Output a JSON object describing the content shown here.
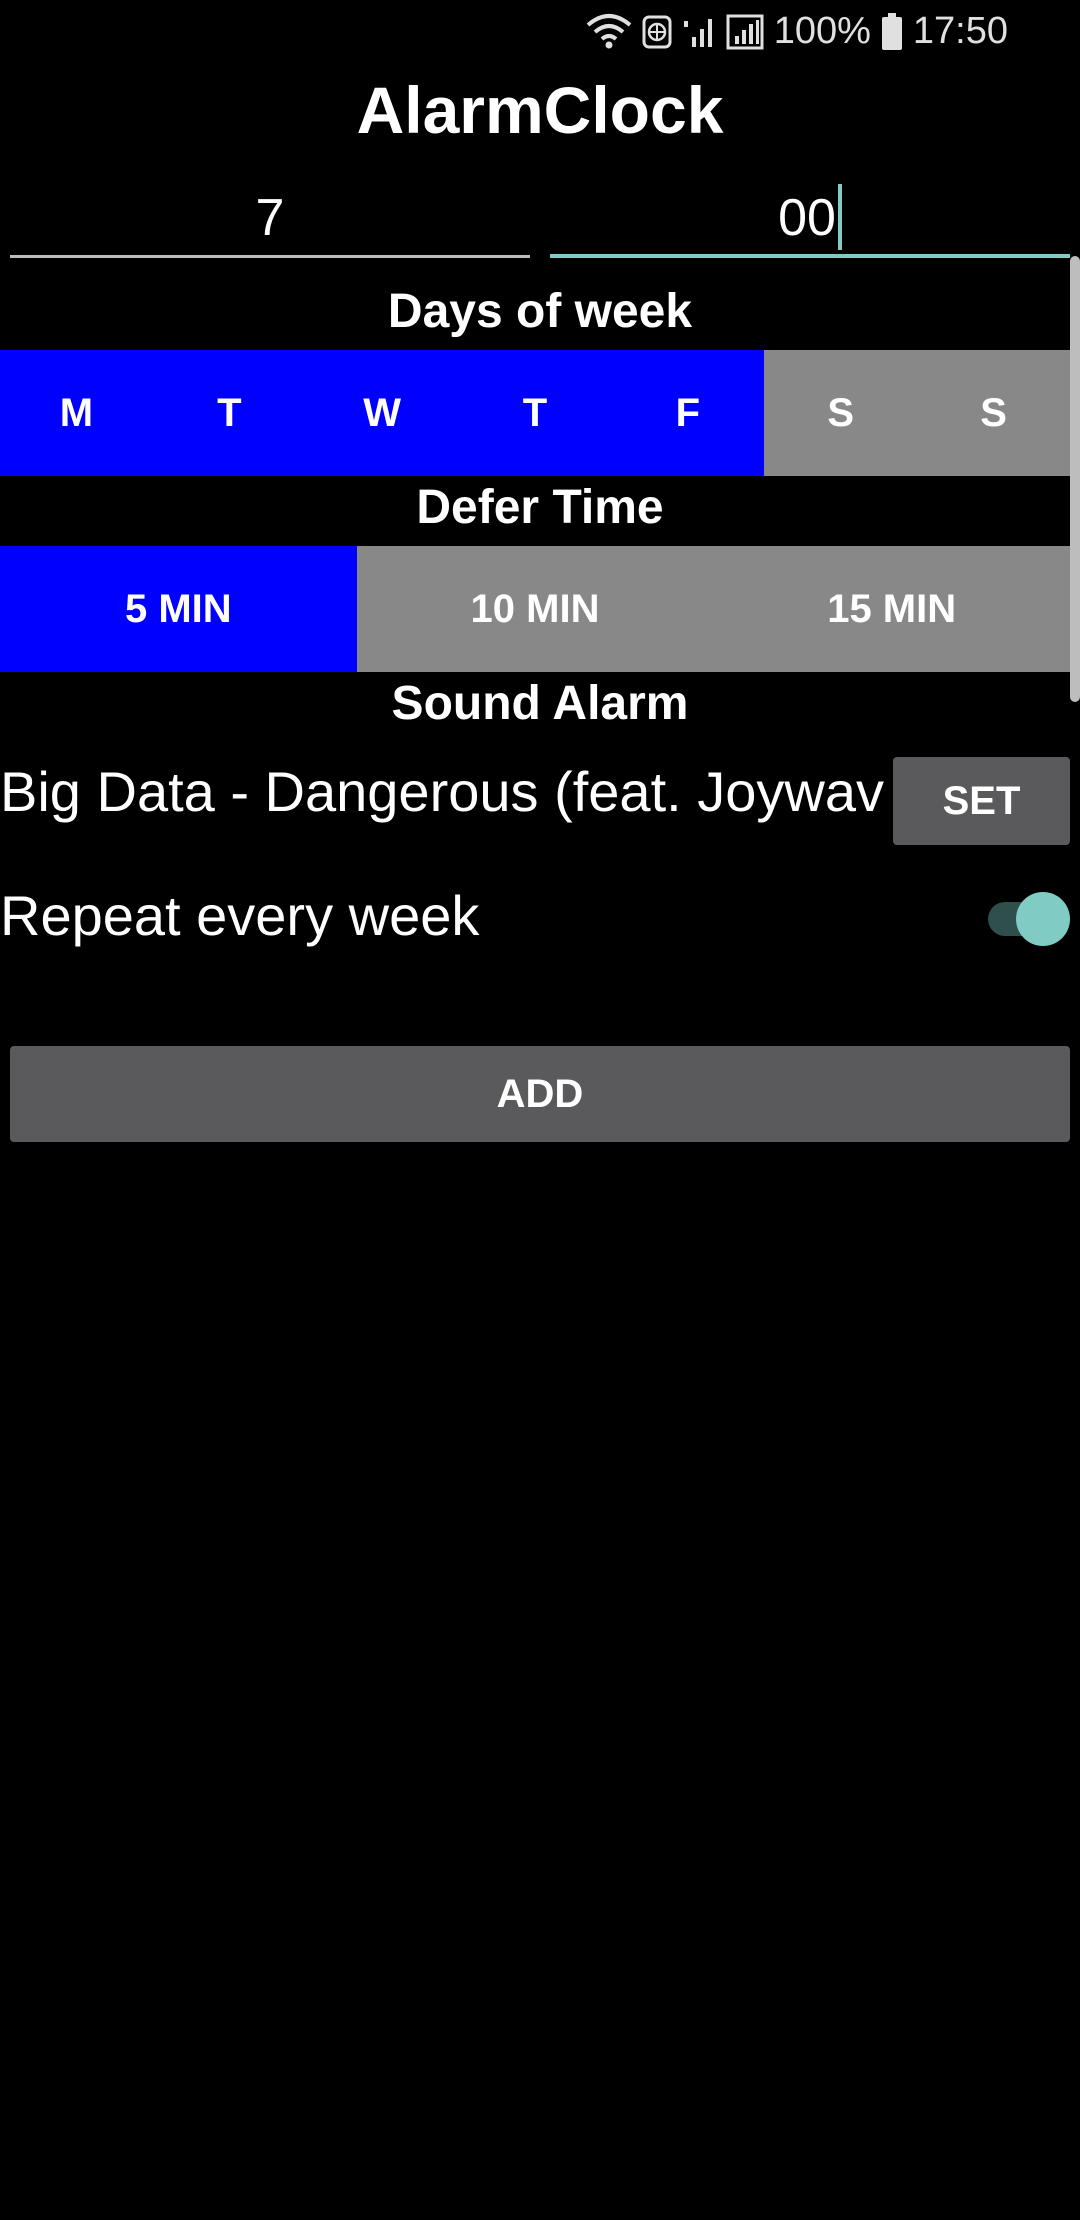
{
  "status_bar": {
    "battery_percent": "100%",
    "time": "17:50",
    "icons": [
      "wifi-icon",
      "vpn-globe-icon",
      "signal-icon",
      "signal-icon",
      "battery-icon"
    ]
  },
  "app": {
    "title": "AlarmClock"
  },
  "time": {
    "hour": "7",
    "minute": "00"
  },
  "days": {
    "label": "Days of week",
    "items": [
      {
        "label": "M",
        "selected": true
      },
      {
        "label": "T",
        "selected": true
      },
      {
        "label": "W",
        "selected": true
      },
      {
        "label": "T",
        "selected": true
      },
      {
        "label": "F",
        "selected": true
      },
      {
        "label": "S",
        "selected": false
      },
      {
        "label": "S",
        "selected": false
      }
    ]
  },
  "defer": {
    "label": "Defer Time",
    "options": [
      {
        "label": "5 MIN",
        "selected": true
      },
      {
        "label": "10 MIN",
        "selected": false
      },
      {
        "label": "15 MIN",
        "selected": false
      }
    ]
  },
  "sound": {
    "label": "Sound Alarm",
    "track": "Big Data - Dangerous (feat. Joywave)",
    "set_label": "SET"
  },
  "repeat": {
    "label": "Repeat every week",
    "enabled": true
  },
  "actions": {
    "add_label": "ADD"
  },
  "colors": {
    "selected": "#0000ff",
    "unselected": "#888888",
    "accent": "#80cbc4",
    "button": "#5a5a5c",
    "background": "#000000"
  }
}
